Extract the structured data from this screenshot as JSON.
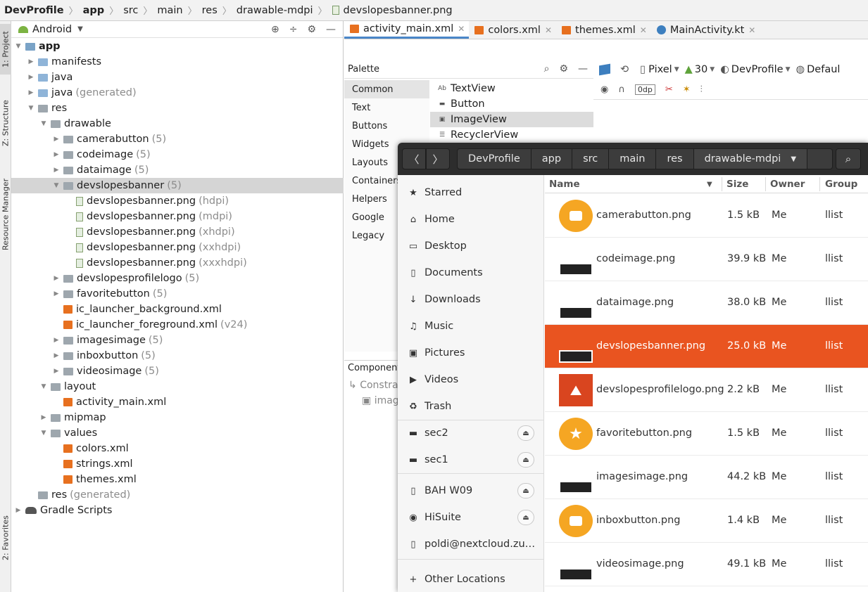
{
  "breadcrumb": {
    "items": [
      "DevProfile",
      "app",
      "src",
      "main",
      "res",
      "drawable-mdpi"
    ],
    "file": "devslopesbanner.png"
  },
  "tool_strip": {
    "tabs": [
      "1: Project",
      "Z: Structure",
      "Resource Manager",
      "2: Favorites"
    ]
  },
  "project": {
    "view_mode": "Android",
    "tree": [
      {
        "label": "app",
        "suffix": "",
        "indent": 0,
        "arrow": "▼",
        "icon": "module",
        "bold": true
      },
      {
        "label": "manifests",
        "suffix": "",
        "indent": 1,
        "arrow": "▶",
        "icon": "folder-blue"
      },
      {
        "label": "java",
        "suffix": "",
        "indent": 1,
        "arrow": "▶",
        "icon": "folder-blue"
      },
      {
        "label": "java",
        "suffix": "(generated)",
        "indent": 1,
        "arrow": "▶",
        "icon": "folder-blue"
      },
      {
        "label": "res",
        "suffix": "",
        "indent": 1,
        "arrow": "▼",
        "icon": "folder-grey"
      },
      {
        "label": "drawable",
        "suffix": "",
        "indent": 2,
        "arrow": "▼",
        "icon": "folder-grey"
      },
      {
        "label": "camerabutton",
        "suffix": "(5)",
        "indent": 3,
        "arrow": "▶",
        "icon": "folder-grey"
      },
      {
        "label": "codeimage",
        "suffix": "(5)",
        "indent": 3,
        "arrow": "▶",
        "icon": "folder-grey"
      },
      {
        "label": "dataimage",
        "suffix": "(5)",
        "indent": 3,
        "arrow": "▶",
        "icon": "folder-grey"
      },
      {
        "label": "devslopesbanner",
        "suffix": "(5)",
        "indent": 3,
        "arrow": "▼",
        "icon": "folder-grey",
        "selected": true
      },
      {
        "label": "devslopesbanner.png",
        "suffix": "(hdpi)",
        "indent": 4,
        "arrow": "",
        "icon": "png"
      },
      {
        "label": "devslopesbanner.png",
        "suffix": "(mdpi)",
        "indent": 4,
        "arrow": "",
        "icon": "png"
      },
      {
        "label": "devslopesbanner.png",
        "suffix": "(xhdpi)",
        "indent": 4,
        "arrow": "",
        "icon": "png"
      },
      {
        "label": "devslopesbanner.png",
        "suffix": "(xxhdpi)",
        "indent": 4,
        "arrow": "",
        "icon": "png"
      },
      {
        "label": "devslopesbanner.png",
        "suffix": "(xxxhdpi)",
        "indent": 4,
        "arrow": "",
        "icon": "png"
      },
      {
        "label": "devslopesprofilelogo",
        "suffix": "(5)",
        "indent": 3,
        "arrow": "▶",
        "icon": "folder-grey"
      },
      {
        "label": "favoritebutton",
        "suffix": "(5)",
        "indent": 3,
        "arrow": "▶",
        "icon": "folder-grey"
      },
      {
        "label": "ic_launcher_background.xml",
        "suffix": "",
        "indent": 3,
        "arrow": "",
        "icon": "xml"
      },
      {
        "label": "ic_launcher_foreground.xml",
        "suffix": "(v24)",
        "indent": 3,
        "arrow": "",
        "icon": "xml"
      },
      {
        "label": "imagesimage",
        "suffix": "(5)",
        "indent": 3,
        "arrow": "▶",
        "icon": "folder-grey"
      },
      {
        "label": "inboxbutton",
        "suffix": "(5)",
        "indent": 3,
        "arrow": "▶",
        "icon": "folder-grey"
      },
      {
        "label": "videosimage",
        "suffix": "(5)",
        "indent": 3,
        "arrow": "▶",
        "icon": "folder-grey"
      },
      {
        "label": "layout",
        "suffix": "",
        "indent": 2,
        "arrow": "▼",
        "icon": "folder-grey"
      },
      {
        "label": "activity_main.xml",
        "suffix": "",
        "indent": 3,
        "arrow": "",
        "icon": "xml"
      },
      {
        "label": "mipmap",
        "suffix": "",
        "indent": 2,
        "arrow": "▶",
        "icon": "folder-grey"
      },
      {
        "label": "values",
        "suffix": "",
        "indent": 2,
        "arrow": "▼",
        "icon": "folder-grey"
      },
      {
        "label": "colors.xml",
        "suffix": "",
        "indent": 3,
        "arrow": "",
        "icon": "xml"
      },
      {
        "label": "strings.xml",
        "suffix": "",
        "indent": 3,
        "arrow": "",
        "icon": "xml"
      },
      {
        "label": "themes.xml",
        "suffix": "",
        "indent": 3,
        "arrow": "",
        "icon": "xml"
      },
      {
        "label": "res",
        "suffix": "(generated)",
        "indent": 1,
        "arrow": "",
        "icon": "folder-grey"
      },
      {
        "label": "Gradle Scripts",
        "suffix": "",
        "indent": 0,
        "arrow": "▶",
        "icon": "gradle"
      }
    ]
  },
  "editor_tabs": [
    {
      "label": "activity_main.xml",
      "icon": "xml",
      "active": true
    },
    {
      "label": "colors.xml",
      "icon": "xml",
      "active": false
    },
    {
      "label": "themes.xml",
      "icon": "xml",
      "active": false
    },
    {
      "label": "MainActivity.kt",
      "icon": "kotlin",
      "active": false
    }
  ],
  "palette": {
    "title": "Palette",
    "categories": [
      "Common",
      "Text",
      "Buttons",
      "Widgets",
      "Layouts",
      "Containers",
      "Helpers",
      "Google",
      "Legacy"
    ],
    "selected_category": "Common",
    "items": [
      {
        "label": "TextView",
        "icon": "Ab"
      },
      {
        "label": "Button",
        "icon": "▬"
      },
      {
        "label": "ImageView",
        "icon": "▣",
        "selected": true
      },
      {
        "label": "RecyclerView",
        "icon": "☰"
      }
    ]
  },
  "design_toolbar": {
    "device": "Pixel",
    "api": "30",
    "theme": "DevProfile",
    "locale": "Defaul",
    "margin": "0dp"
  },
  "component_tree": {
    "title": "Component",
    "rows": [
      "Constra",
      "imag"
    ]
  },
  "file_dialog": {
    "path": [
      "DevProfile",
      "app",
      "src",
      "main",
      "res",
      "drawable-mdpi"
    ],
    "sidebar": [
      {
        "label": "Starred",
        "icon": "★"
      },
      {
        "label": "Home",
        "icon": "⌂"
      },
      {
        "label": "Desktop",
        "icon": "▭"
      },
      {
        "label": "Documents",
        "icon": "▯"
      },
      {
        "label": "Downloads",
        "icon": "↓"
      },
      {
        "label": "Music",
        "icon": "♫"
      },
      {
        "label": "Pictures",
        "icon": "▣"
      },
      {
        "label": "Videos",
        "icon": "▶"
      },
      {
        "label": "Trash",
        "icon": "♻"
      },
      {
        "label": "sec2",
        "icon": "▬",
        "eject": true
      },
      {
        "label": "sec1",
        "icon": "▬",
        "eject": true
      },
      {
        "label": "BAH W09",
        "icon": "▯",
        "eject": true
      },
      {
        "label": "HiSuite",
        "icon": "◉",
        "eject": true
      },
      {
        "label": "poldi@nextcloud.zu…",
        "icon": "▯"
      },
      {
        "label": "Other Locations",
        "icon": "+"
      }
    ],
    "columns": [
      "Name",
      "Size",
      "Owner",
      "Group"
    ],
    "files": [
      {
        "name": "camerabutton.png",
        "size": "1.5 kB",
        "owner": "Me",
        "group": "llist",
        "thumb": "orange-circle"
      },
      {
        "name": "codeimage.png",
        "size": "39.9 kB",
        "owner": "Me",
        "group": "llist",
        "thumb": "dark"
      },
      {
        "name": "dataimage.png",
        "size": "38.0 kB",
        "owner": "Me",
        "group": "llist",
        "thumb": "dark"
      },
      {
        "name": "devslopesbanner.png",
        "size": "25.0 kB",
        "owner": "Me",
        "group": "llist",
        "thumb": "dark",
        "selected": true
      },
      {
        "name": "devslopesprofilelogo.png",
        "size": "2.2 kB",
        "owner": "Me",
        "group": "llist",
        "thumb": "red-square"
      },
      {
        "name": "favoritebutton.png",
        "size": "1.5 kB",
        "owner": "Me",
        "group": "llist",
        "thumb": "orange-circle-star"
      },
      {
        "name": "imagesimage.png",
        "size": "44.2 kB",
        "owner": "Me",
        "group": "llist",
        "thumb": "dark"
      },
      {
        "name": "inboxbutton.png",
        "size": "1.4 kB",
        "owner": "Me",
        "group": "llist",
        "thumb": "orange-circle"
      },
      {
        "name": "videosimage.png",
        "size": "49.1 kB",
        "owner": "Me",
        "group": "llist",
        "thumb": "dark"
      }
    ]
  },
  "colors": {
    "selection_orange": "#e95420",
    "thumb_orange": "#f5a623",
    "header_dark": "#2d2d2d"
  }
}
